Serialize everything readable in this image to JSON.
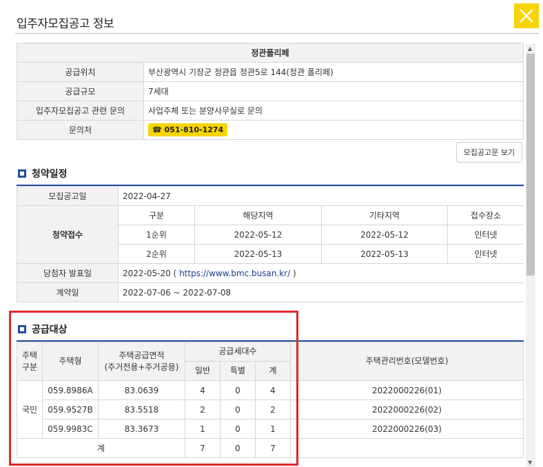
{
  "dialog": {
    "title": "입주자모집공고 정보"
  },
  "info": {
    "header": "정관폴리페",
    "rows": [
      {
        "label": "공급위치",
        "value": "부산광역시 기장군 정관읍 정관5로 144(정관 폴리페)"
      },
      {
        "label": "공급규모",
        "value": "7세대"
      },
      {
        "label": "입주자모집공고 관련 문의",
        "value": "사업주체 또는 분양사무실로 문의"
      }
    ],
    "contact_label": "문의처",
    "phone": "☎ 051-810-1274"
  },
  "notice_button": "모집공고문 보기",
  "schedule": {
    "title": "청약일정",
    "announce_label": "모집공고일",
    "announce_date": "2022-04-27",
    "apply_label": "청약접수",
    "headers": [
      "구분",
      "해당지역",
      "기타지역",
      "접수장소"
    ],
    "rows": [
      {
        "rank": "1순위",
        "local": "2022-05-12",
        "other": "2022-05-12",
        "place": "인터넷"
      },
      {
        "rank": "2순위",
        "local": "2022-05-13",
        "other": "2022-05-13",
        "place": "인터넷"
      }
    ],
    "winner_label": "당첨자 발표일",
    "winner_date": "2022-05-20 (",
    "winner_link": "https://www.bmc.busan.kr/",
    "winner_close": ")",
    "contract_label": "계약일",
    "contract_date": "2022-07-06 ~ 2022-07-08"
  },
  "supply": {
    "title": "공급대상",
    "headers": {
      "house_kind": "주택\n구분",
      "house_type": "주택형",
      "area": "주택공급면적\n(주거전용+주거공용)",
      "units": "공급세대수",
      "general": "일반",
      "special": "특별",
      "total": "계",
      "model": "주택관리번호(모델번호)"
    },
    "kind": "국민",
    "rows": [
      {
        "type": "059.8986A",
        "area": "83.0639",
        "general": "4",
        "special": "0",
        "total": "4",
        "model": "2022000226(01)"
      },
      {
        "type": "059.9527B",
        "area": "83.5518",
        "general": "2",
        "special": "0",
        "total": "2",
        "model": "2022000226(02)"
      },
      {
        "type": "059.9983C",
        "area": "83.3673",
        "general": "1",
        "special": "0",
        "total": "1",
        "model": "2022000226(03)"
      }
    ],
    "sum_label": "계",
    "sum_general": "7",
    "sum_special": "0",
    "sum_total": "7"
  },
  "colors": {
    "accent": "#f5d400",
    "section": "#1f4e9e",
    "highlight": "#e0252a"
  }
}
